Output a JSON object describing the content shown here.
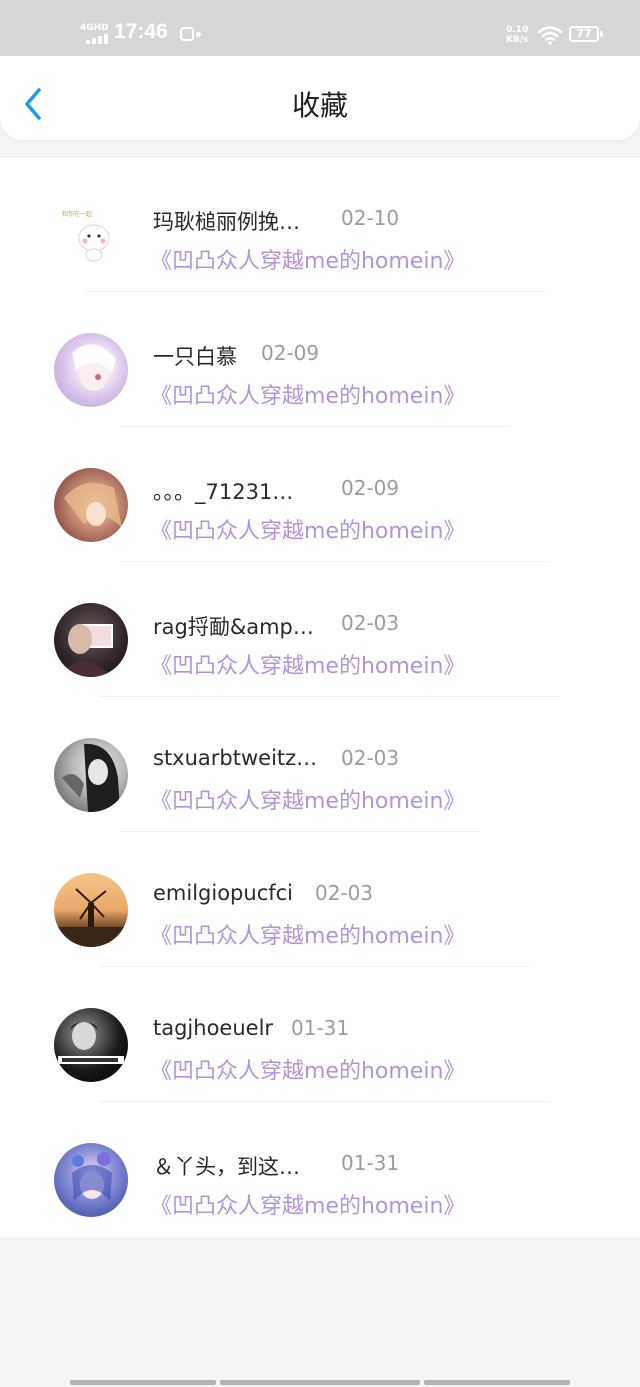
{
  "status_bar": {
    "network": "4GHD",
    "time": "17:46",
    "speed_value": "0.10",
    "speed_unit": "KB/s",
    "battery": "77"
  },
  "header": {
    "title": "收藏",
    "back_icon": "chevron-left-icon"
  },
  "colors": {
    "accent_blue": "#1c9be6",
    "book_purple": "#b493d6",
    "status_bar_bg": "#d7d7d7"
  },
  "favorites": [
    {
      "name": "玛耿槌丽例挽…",
      "date": "02-10",
      "book": "《凹凸众人穿越me的homein》"
    },
    {
      "name": "一只白慕",
      "date": "02-09",
      "book": "《凹凸众人穿越me的homein》"
    },
    {
      "name": "。。。_71231…",
      "date": "02-09",
      "book": "《凹凸众人穿越me的homein》"
    },
    {
      "name": "rag捋勔&amp…",
      "date": "02-03",
      "book": "《凹凸众人穿越me的homein》"
    },
    {
      "name": "stxuarbtweitz…",
      "date": "02-03",
      "book": "《凹凸众人穿越me的homein》"
    },
    {
      "name": "emilgiopucfci",
      "date": "02-03",
      "book": "《凹凸众人穿越me的homein》"
    },
    {
      "name": "tagjhoeuelr",
      "date": "01-31",
      "book": "《凹凸众人穿越me的homein》"
    },
    {
      "name": "＆丫头，到这…",
      "date": "01-31",
      "book": "《凹凸众人穿越me的homein》"
    }
  ]
}
